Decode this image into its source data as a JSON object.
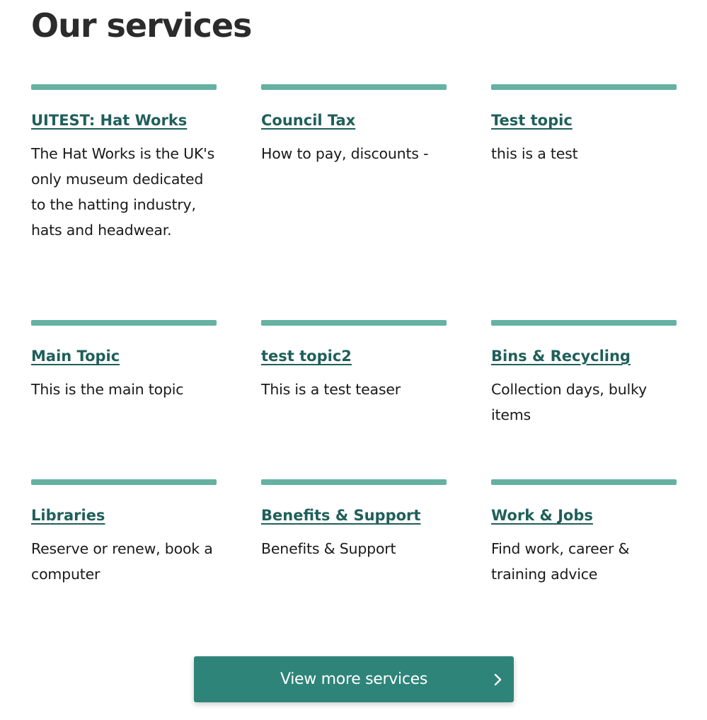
{
  "page_title": "Our services",
  "services": [
    {
      "title": "UITEST: Hat Works",
      "description": "The Hat Works is the UK's only museum dedicated to the hatting industry, hats and headwear."
    },
    {
      "title": "Council Tax",
      "description": "How to pay, discounts -"
    },
    {
      "title": "Test topic",
      "description": "this is a test"
    },
    {
      "title": "Main Topic",
      "description": "This is the main topic"
    },
    {
      "title": "test topic2",
      "description": "This is a test teaser"
    },
    {
      "title": "Bins & Recycling",
      "description": "Collection days, bulky items"
    },
    {
      "title": "Libraries",
      "description": "Reserve or renew, book a computer"
    },
    {
      "title": "Benefits & Support",
      "description": "Benefits & Support"
    },
    {
      "title": "Work & Jobs",
      "description": "Find work, career & training advice"
    }
  ],
  "view_more_label": "View more services",
  "icons": {
    "button_icon": "chevron-right-icon"
  },
  "colors": {
    "accent_bar": "#65b1a2",
    "link": "#1f5f5b",
    "button": "#2f8479"
  }
}
